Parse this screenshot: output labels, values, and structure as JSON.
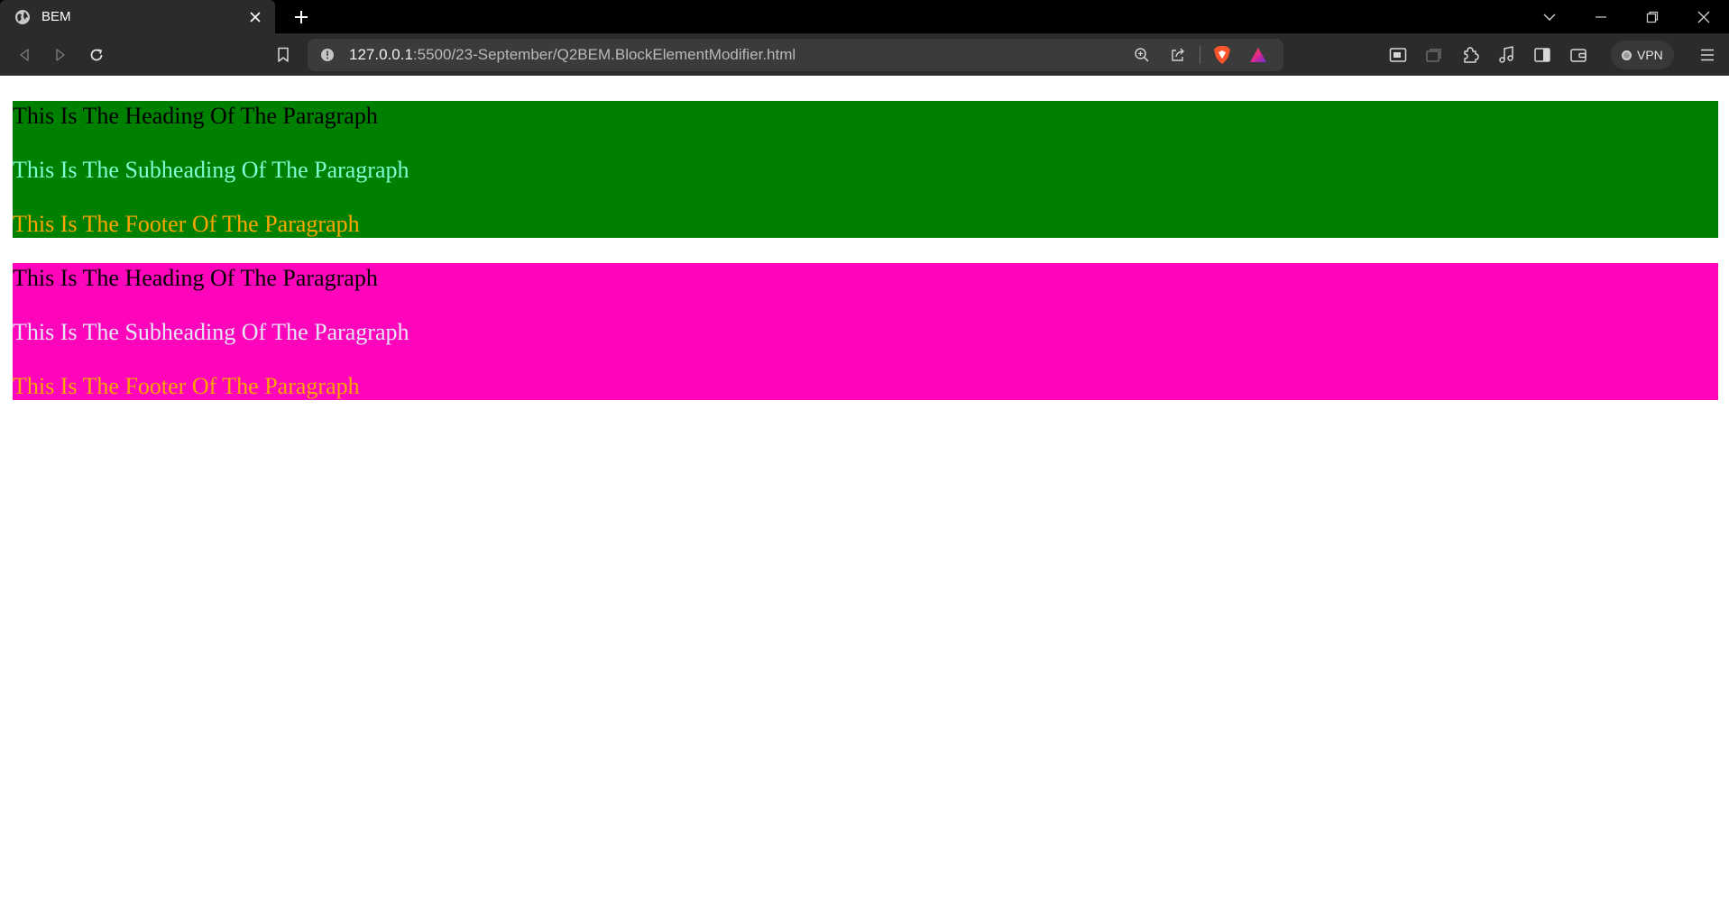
{
  "browser": {
    "tab": {
      "title": "BEM",
      "favicon": "globe-icon"
    },
    "address_bar": {
      "host": "127.0.0.1",
      "path": ":5500/23-September/Q2BEM.BlockElementModifier.html"
    },
    "vpn_label": "VPN"
  },
  "page": {
    "blocks": [
      {
        "background": "#008000",
        "heading": "This Is The Heading Of The Paragraph",
        "heading_color": "#000000",
        "subheading": "This Is The Subheading Of The Paragraph",
        "subheading_color": "#7fffd4",
        "footer": "This Is The Footer Of The Paragraph",
        "footer_color": "#ffa500"
      },
      {
        "background": "#ff05bb",
        "heading": "This Is The Heading Of The Paragraph",
        "heading_color": "#000000",
        "subheading": "This Is The Subheading Of The Paragraph",
        "subheading_color": "#e6e6fa",
        "footer": "This Is The Footer Of The Paragraph",
        "footer_color": "#ffa500"
      }
    ]
  }
}
